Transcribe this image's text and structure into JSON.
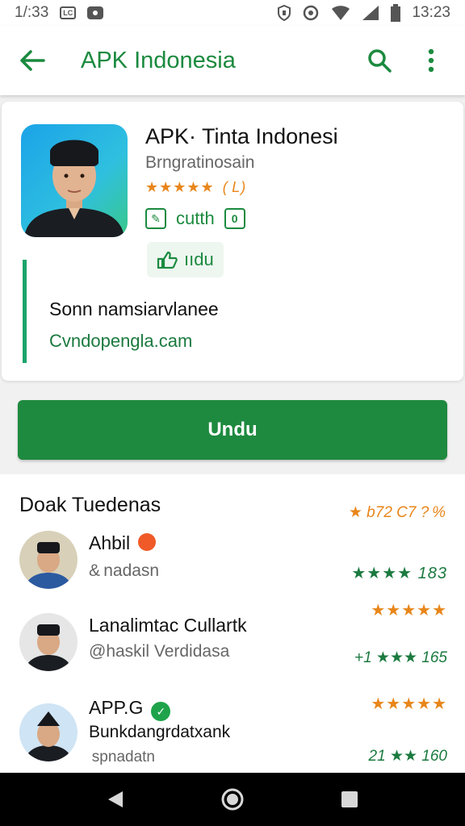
{
  "status_bar": {
    "time_left": "1/:33",
    "time_right": "13:23",
    "left_icons": [
      "app-badge-icon",
      "notification-icon"
    ],
    "right_icons": [
      "shield-icon",
      "sync-icon",
      "wifi-icon",
      "signal-icon",
      "battery-icon"
    ]
  },
  "app_bar": {
    "title": "APK Indonesia",
    "icons": [
      "back-arrow-icon",
      "search-icon",
      "more-vert-icon"
    ]
  },
  "app_details": {
    "name": "APK· Tinta Indonesi",
    "developer": "Brngratinosain",
    "stars": "★★★★★",
    "rating_count": "( L)",
    "edit_label": "cutth",
    "small_button_label": "ııdu",
    "description": "Sonn namsiarvlanee",
    "link": "Cvndopengla.cam"
  },
  "download_button": {
    "label": "Undu"
  },
  "reviews": {
    "title": "Doak Tuedenas",
    "summary": "★ b72 C7 ? %",
    "items": [
      {
        "name": "Ahbil",
        "subtitle": "& nadasn",
        "stars_text": "★★★★",
        "score": "183",
        "badge": "heart"
      },
      {
        "name": "Lanalimtac Cullartk",
        "subtitle": "@haskil Verdidasa",
        "stars_text": "★★★★★",
        "score": "+1 ★★★ 165",
        "badge": ""
      },
      {
        "name": "APP.G",
        "subtitle": "Bunkdangrdatxank",
        "subtitle2": " spnadatn",
        "stars_text": "★★★★★",
        "score": "21 ★★ 160",
        "badge": "verified"
      }
    ]
  },
  "colors": {
    "accent_green": "#1e8a3f",
    "star_orange": "#e8861a",
    "star_teal": "#1ea3b0",
    "star_green": "#1b7a3f"
  }
}
